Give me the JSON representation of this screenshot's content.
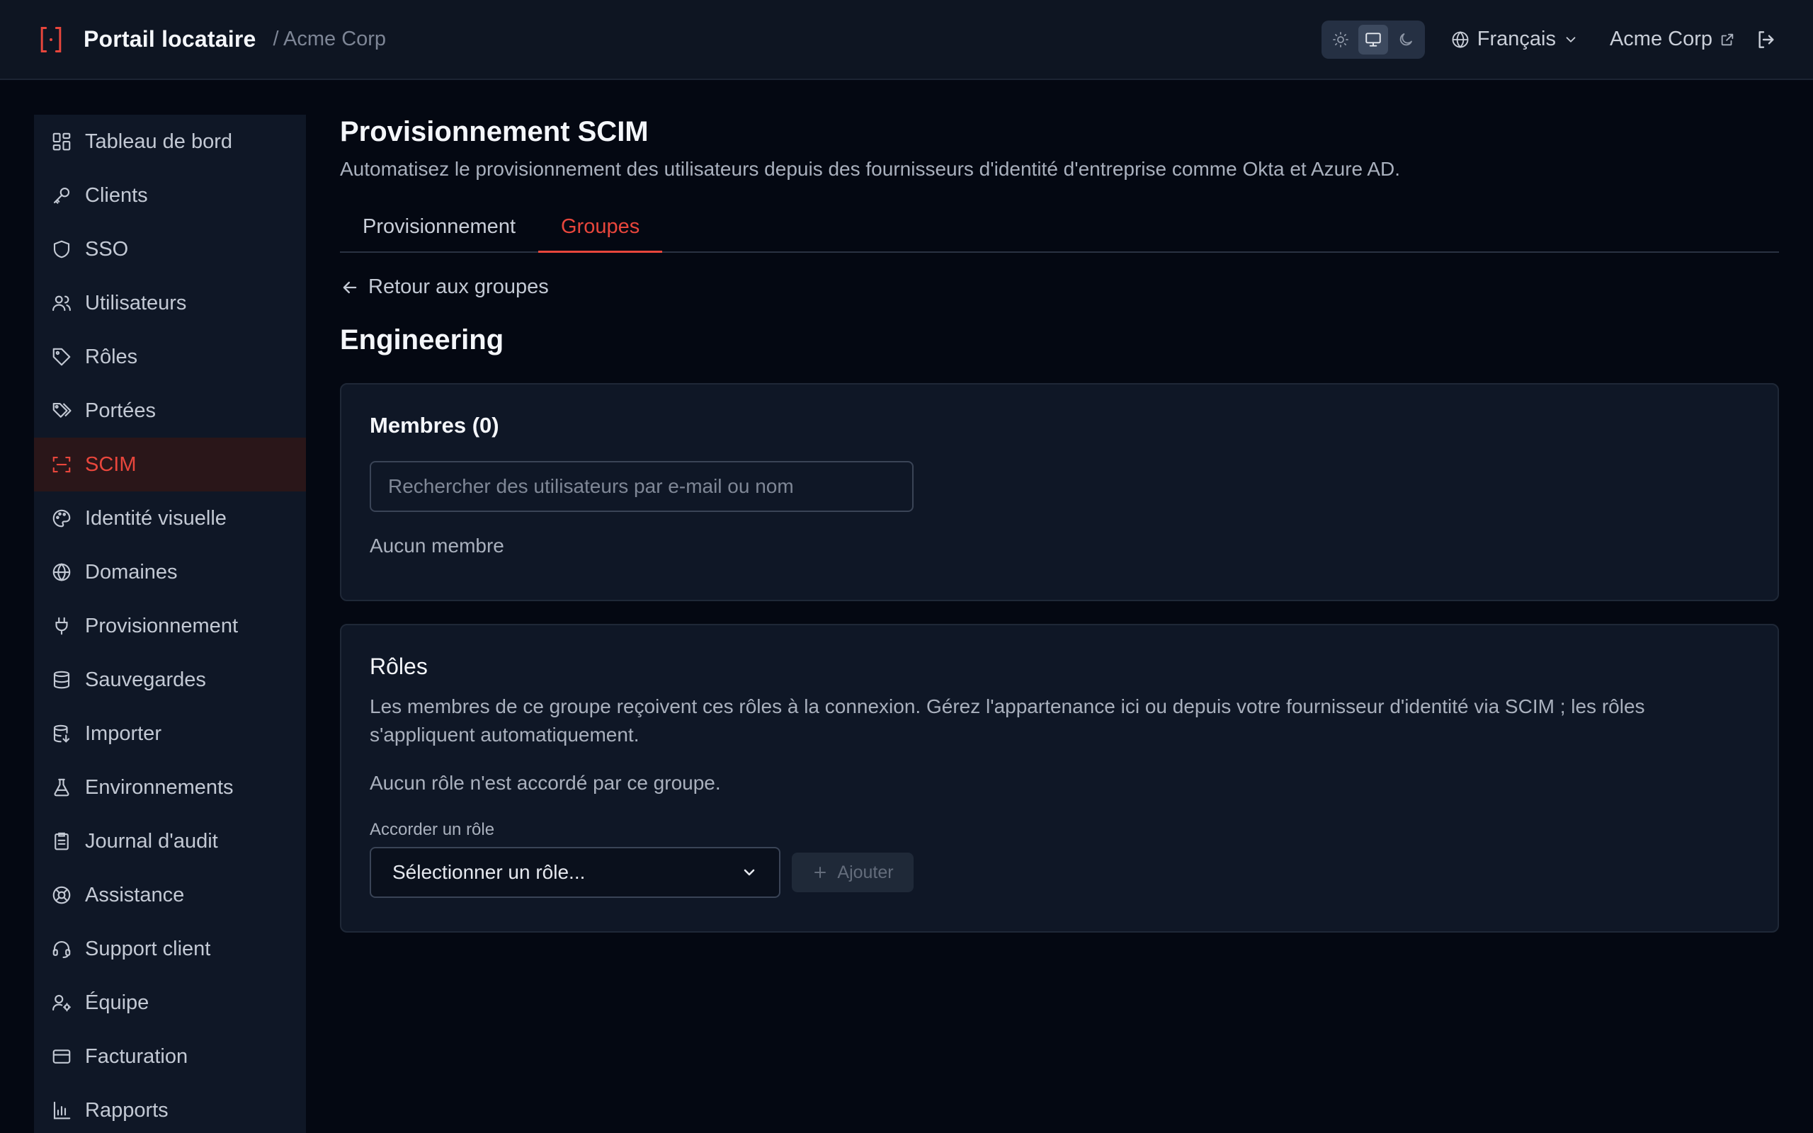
{
  "header": {
    "title": "Portail locataire",
    "breadcrumb": "/ Acme Corp",
    "language": "Français",
    "tenant": "Acme Corp"
  },
  "sidebar": {
    "items": [
      {
        "label": "Tableau de bord",
        "icon": "dashboard-icon"
      },
      {
        "label": "Clients",
        "icon": "key-icon"
      },
      {
        "label": "SSO",
        "icon": "shield-icon"
      },
      {
        "label": "Utilisateurs",
        "icon": "users-icon"
      },
      {
        "label": "Rôles",
        "icon": "tag-icon"
      },
      {
        "label": "Portées",
        "icon": "tags-icon"
      },
      {
        "label": "SCIM",
        "icon": "scan-icon",
        "active": true
      },
      {
        "label": "Identité visuelle",
        "icon": "palette-icon"
      },
      {
        "label": "Domaines",
        "icon": "globe-icon"
      },
      {
        "label": "Provisionnement",
        "icon": "plug-icon"
      },
      {
        "label": "Sauvegardes",
        "icon": "database-icon"
      },
      {
        "label": "Importer",
        "icon": "database-import-icon"
      },
      {
        "label": "Environnements",
        "icon": "flask-icon"
      },
      {
        "label": "Journal d'audit",
        "icon": "clipboard-icon"
      },
      {
        "label": "Assistance",
        "icon": "lifebuoy-icon"
      },
      {
        "label": "Support client",
        "icon": "headset-icon"
      },
      {
        "label": "Équipe",
        "icon": "user-cog-icon"
      },
      {
        "label": "Facturation",
        "icon": "credit-card-icon"
      },
      {
        "label": "Rapports",
        "icon": "bar-chart-icon"
      }
    ]
  },
  "page": {
    "title": "Provisionnement SCIM",
    "subtitle": "Automatisez le provisionnement des utilisateurs depuis des fournisseurs d'identité d'entreprise comme Okta et Azure AD.",
    "tabs": [
      {
        "label": "Provisionnement",
        "active": false
      },
      {
        "label": "Groupes",
        "active": true
      }
    ],
    "back_label": "Retour aux groupes",
    "group_name": "Engineering"
  },
  "members": {
    "title": "Membres (0)",
    "search_placeholder": "Rechercher des utilisateurs par e-mail ou nom",
    "empty": "Aucun membre"
  },
  "roles": {
    "title": "Rôles",
    "description": "Les membres de ce groupe reçoivent ces rôles à la connexion. Gérez l'appartenance ici ou depuis votre fournisseur d'identité via SCIM ; les rôles s'appliquent automatiquement.",
    "empty": "Aucun rôle n'est accordé par ce groupe.",
    "grant_label": "Accorder un rôle",
    "select_value": "Sélectionner un rôle...",
    "add_label": "Ajouter"
  },
  "colors": {
    "accent": "#e8463c",
    "background": "#040812",
    "surface": "#0f1726"
  }
}
